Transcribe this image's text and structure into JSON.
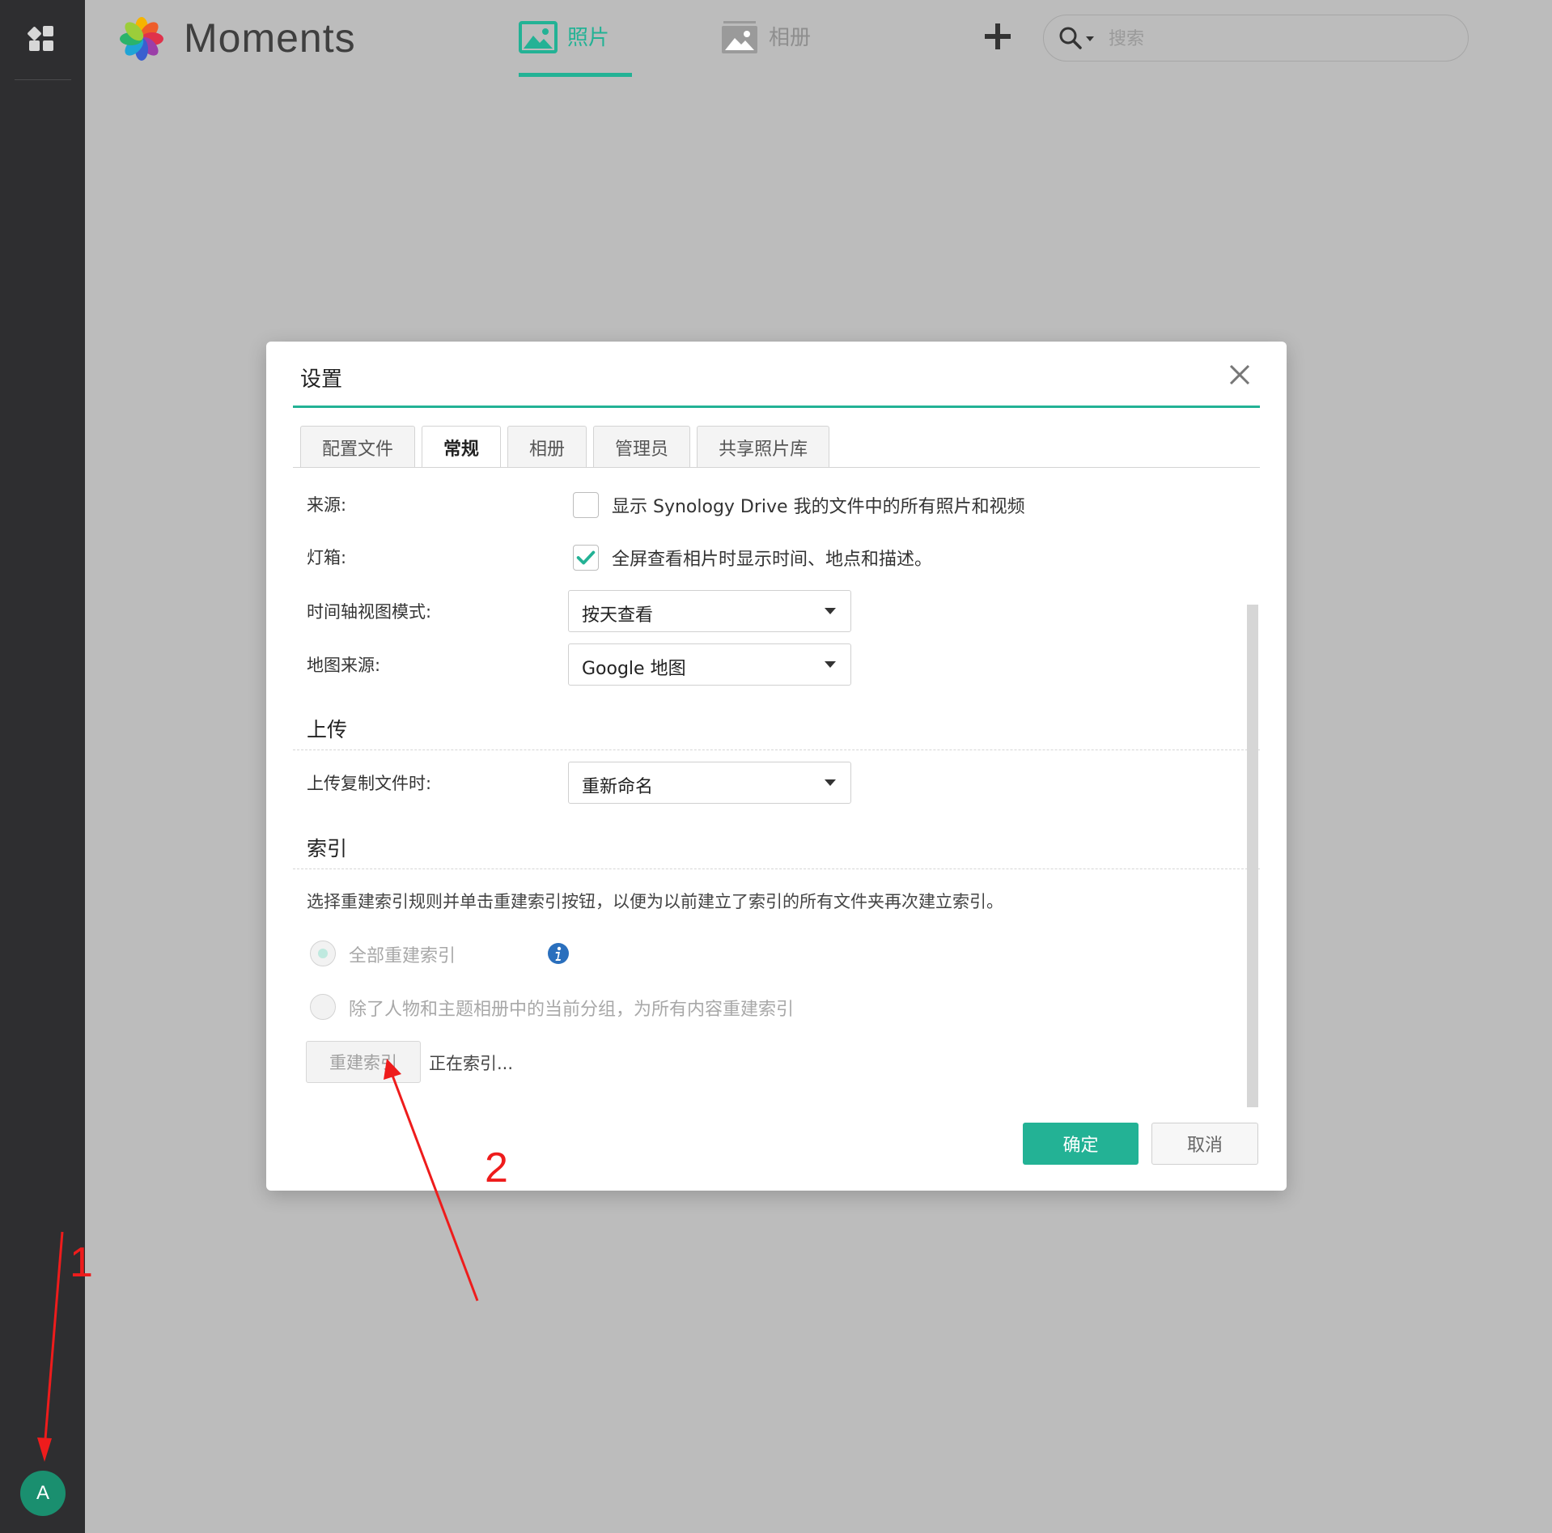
{
  "app": {
    "title": "Moments",
    "avatar_letter": "A"
  },
  "header": {
    "tabs": [
      {
        "label": "照片",
        "icon": "photo-icon",
        "active": true
      },
      {
        "label": "相册",
        "icon": "album-icon",
        "active": false
      }
    ],
    "search": {
      "placeholder": "搜索"
    }
  },
  "dialog": {
    "title": "设置",
    "tabs": [
      "配置文件",
      "常规",
      "相册",
      "管理员",
      "共享照片库"
    ],
    "active_tab": "常规",
    "rows": {
      "source": {
        "label": "来源:",
        "text": "显示 Synology Drive 我的文件中的所有照片和视频",
        "checked": false
      },
      "lightbox": {
        "label": "灯箱:",
        "text": "全屏查看相片时显示时间、地点和描述。",
        "checked": true
      },
      "timeline": {
        "label": "时间轴视图模式:",
        "value": "按天查看"
      },
      "map": {
        "label": "地图来源:",
        "value": "Google 地图"
      }
    },
    "upload": {
      "heading": "上传",
      "dup_label": "上传复制文件时:",
      "dup_value": "重新命名"
    },
    "index": {
      "heading": "索引",
      "description": "选择重建索引规则并单击重建索引按钮，以便为以前建立了索引的所有文件夹再次建立索引。",
      "options": [
        "全部重建索引",
        "除了人物和主题相册中的当前分组，为所有内容重建索引"
      ],
      "selected_option": 0,
      "rebuild_button": "重建索引",
      "status": "正在索引..."
    },
    "ok_label": "确定",
    "cancel_label": "取消"
  },
  "annotations": {
    "marker_1": "1",
    "marker_2": "2",
    "color": "#ee1c1c"
  },
  "colors": {
    "accent": "#23b295",
    "rail": "#2e2e30",
    "backdrop": "#bcbcbc",
    "avatar": "#1a8f6f"
  }
}
